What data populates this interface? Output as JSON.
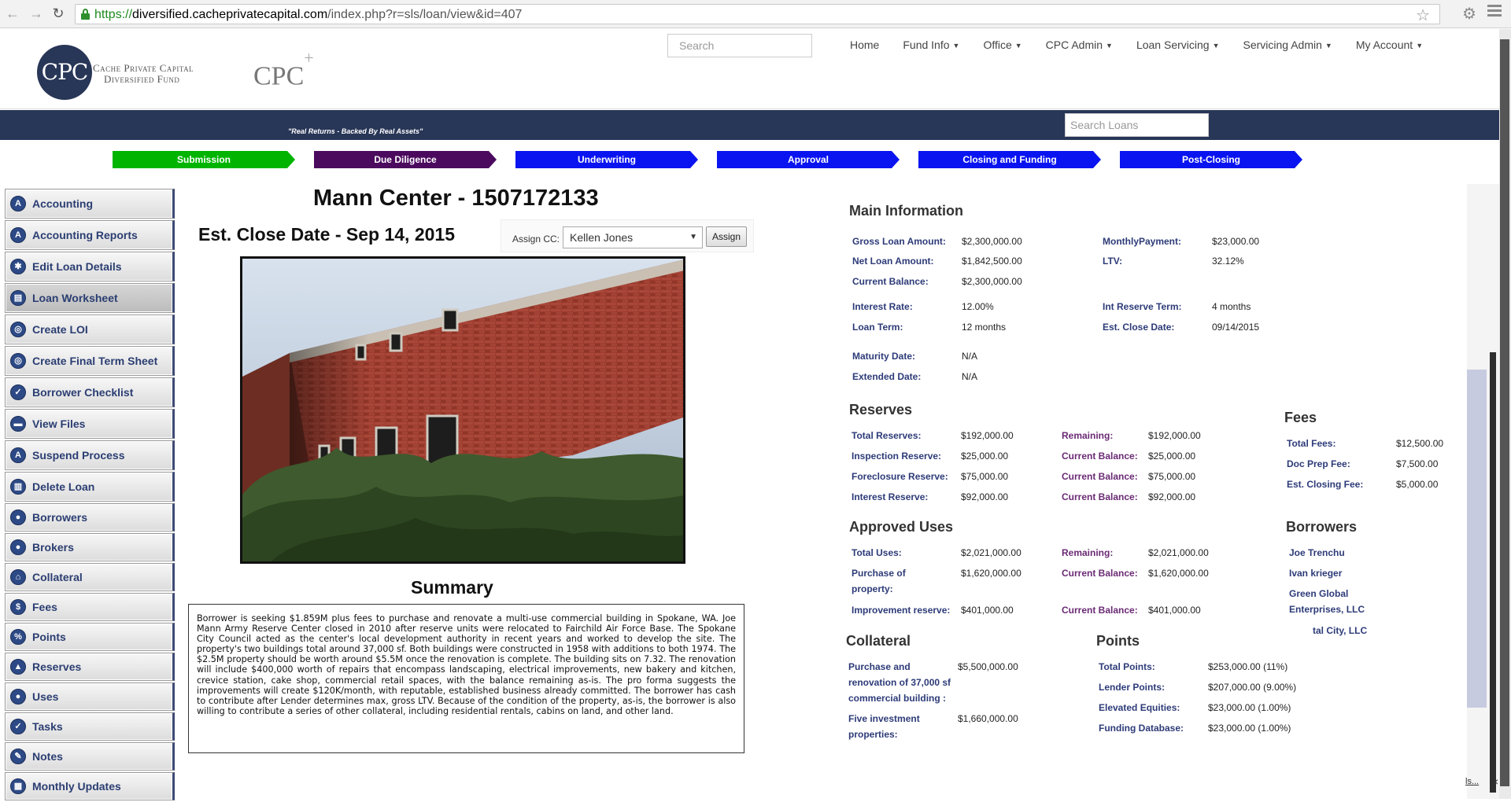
{
  "browser": {
    "url_https": "https://",
    "url_host": "diversified.cacheprivatecapital.com",
    "url_path": "/index.php?r=sls/loan/view&id=407"
  },
  "header": {
    "logo_mark": "CPC",
    "logo_line1": "Cache Private Capital",
    "logo_line2": "Diversified Fund",
    "logo_cpc_plus": "CPC",
    "search_placeholder": "Search",
    "nav": [
      "Home",
      "Fund Info",
      "Office",
      "CPC Admin",
      "Loan Servicing",
      "Servicing Admin",
      "My Account"
    ],
    "tagline": "\"Real Returns - Backed By Real Assets\"",
    "search_loans_placeholder": "Search Loans"
  },
  "steps": [
    {
      "label": "Submission",
      "color": "#00b400"
    },
    {
      "label": "Due Diligence",
      "color": "#4b0a5e"
    },
    {
      "label": "Underwriting",
      "color": "#0a14f0"
    },
    {
      "label": "Approval",
      "color": "#0a14f0"
    },
    {
      "label": "Closing and Funding",
      "color": "#0a14f0"
    },
    {
      "label": "Post-Closing",
      "color": "#0a14f0"
    }
  ],
  "sidebar": [
    {
      "label": "Accounting",
      "icon": "accounting-icon"
    },
    {
      "label": "Accounting Reports",
      "icon": "accounting-reports-icon"
    },
    {
      "label": "Edit Loan Details",
      "icon": "edit-icon"
    },
    {
      "label": "Loan Worksheet",
      "icon": "worksheet-icon"
    },
    {
      "label": "Create LOI",
      "icon": "loi-icon"
    },
    {
      "label": "Create Final Term Sheet",
      "icon": "term-sheet-icon"
    },
    {
      "label": "Borrower Checklist",
      "icon": "checklist-icon"
    },
    {
      "label": "View Files",
      "icon": "folder-icon"
    },
    {
      "label": "Suspend Process",
      "icon": "suspend-icon"
    },
    {
      "label": "Delete Loan",
      "icon": "trash-icon"
    },
    {
      "label": "Borrowers",
      "icon": "borrowers-icon"
    },
    {
      "label": "Brokers",
      "icon": "brokers-icon"
    },
    {
      "label": "Collateral",
      "icon": "home-icon"
    },
    {
      "label": "Fees",
      "icon": "dollar-icon"
    },
    {
      "label": "Points",
      "icon": "percent-icon"
    },
    {
      "label": "Reserves",
      "icon": "bank-icon"
    },
    {
      "label": "Uses",
      "icon": "uses-icon"
    },
    {
      "label": "Tasks",
      "icon": "check-icon"
    },
    {
      "label": "Notes",
      "icon": "pencil-icon"
    },
    {
      "label": "Monthly Updates",
      "icon": "calendar-icon"
    }
  ],
  "loan": {
    "title": "Mann Center - 1507172133",
    "close_date": "Est. Close Date - Sep 14, 2015",
    "assign_label": "Assign CC:",
    "assign_value": "Kellen Jones",
    "assign_button": "Assign",
    "summary_title": "Summary",
    "summary_text": "Borrower is seeking $1.859M plus fees to purchase and renovate a multi-use commercial building in Spokane, WA. Joe Mann Army Reserve Center closed in 2010 after reserve units were relocated to Fairchild Air Force Base. The Spokane City Council acted as the center's local development authority in recent years and worked to develop the site. The property's two buildings total around 37,000 sf. Both buildings were constructed in 1958 with additions to both 1974. The $2.5M property should be worth around $5.5M once the renovation is complete. The building sits on 7.32. The renovation will include $400,000 worth of repairs that encompass landscaping, electrical improvements, new bakery and kitchen, crevice station, cake shop, commercial retail spaces, with the balance remaining as-is. The pro forma suggests the improvements will create $120K/month, with reputable, established business already committed. The borrower has cash to contribute after Lender determines max, gross LTV. Because of the condition of the property, as-is, the borrower is also willing to contribute a series of other collateral, including residential rentals, cabins on land, and other land."
  },
  "main_info": {
    "title": "Main Information",
    "gross_loan_label": "Gross Loan Amount:",
    "gross_loan": "$2,300,000.00",
    "net_loan_label": "Net Loan Amount:",
    "net_loan": "$1,842,500.00",
    "current_balance_label": "Current Balance:",
    "current_balance": "$2,300,000.00",
    "monthly_payment_label": "MonthlyPayment:",
    "monthly_payment": "$23,000.00",
    "ltv_label": "LTV:",
    "ltv": "32.12%",
    "interest_rate_label": "Interest Rate:",
    "interest_rate": "12.00%",
    "loan_term_label": "Loan Term:",
    "loan_term": "12 months",
    "int_reserve_term_label": "Int Reserve Term:",
    "int_reserve_term": "4 months",
    "est_close_label": "Est. Close Date:",
    "est_close": "09/14/2015",
    "maturity_label": "Maturity Date:",
    "maturity": "N/A",
    "extended_label": "Extended Date:",
    "extended": "N/A"
  },
  "reserves": {
    "title": "Reserves",
    "rows": [
      {
        "label": "Total Reserves:",
        "value": "$192,000.00",
        "rlabel": "Remaining:",
        "rvalue": "$192,000.00"
      },
      {
        "label": "Inspection Reserve:",
        "value": "$25,000.00",
        "rlabel": "Current Balance:",
        "rvalue": "$25,000.00"
      },
      {
        "label": "Foreclosure Reserve:",
        "value": "$75,000.00",
        "rlabel": "Current Balance:",
        "rvalue": "$75,000.00"
      },
      {
        "label": "Interest Reserve:",
        "value": "$92,000.00",
        "rlabel": "Current Balance:",
        "rvalue": "$92,000.00"
      }
    ]
  },
  "fees": {
    "title": "Fees",
    "rows": [
      {
        "label": "Total Fees:",
        "value": "$12,500.00"
      },
      {
        "label": "Doc Prep Fee:",
        "value": "$7,500.00"
      },
      {
        "label": "Est. Closing Fee:",
        "value": "$5,000.00"
      }
    ]
  },
  "uses": {
    "title": "Approved Uses",
    "total_label": "Total Uses:",
    "total": "$2,021,000.00",
    "remaining_label": "Remaining:",
    "remaining": "$2,021,000.00",
    "purchase_label_1": "Purchase of",
    "purchase_label_2": "property:",
    "purchase": "$1,620,000.00",
    "purchase_cb_label": "Current Balance:",
    "purchase_cb": "$1,620,000.00",
    "improve_label": "Improvement reserve:",
    "improve": "$401,000.00",
    "improve_cb_label": "Current Balance:",
    "improve_cb": "$401,000.00"
  },
  "borrowers": {
    "title": "Borrowers",
    "b1": "Joe Trenchu",
    "b2": "Ivan krieger",
    "b3_1": "Green Global",
    "b3_2": "Enterprises, LLC",
    "b4": "tal City, LLC"
  },
  "collateral": {
    "title": "Collateral",
    "c1_l1": "Purchase and",
    "c1_l2": "renovation of 37,000 sf",
    "c1_l3": "commercial building :",
    "c1_value": "$5,500,000.00",
    "c2_l1": "Five investment",
    "c2_l2": "properties:",
    "c2_value": "$1,660,000.00"
  },
  "points": {
    "title": "Points",
    "rows": [
      {
        "label": "Total Points:",
        "value": "$253,000.00 (11%)"
      },
      {
        "label": "Lender Points:",
        "value": "$207,000.00 (9.00%)"
      },
      {
        "label": "Elevated Equities:",
        "value": "$23,000.00 (1.00%)"
      },
      {
        "label": "Funding Database:",
        "value": "$23,000.00 (1.00%)"
      }
    ]
  },
  "corner": {
    "link": "ls...",
    "close": "×"
  }
}
